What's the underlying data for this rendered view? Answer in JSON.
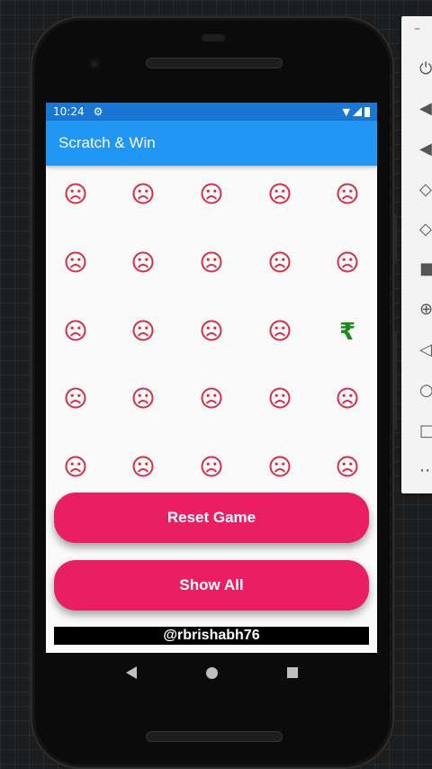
{
  "status_bar": {
    "time": "10:24"
  },
  "app_bar": {
    "title": "Scratch & Win"
  },
  "grid": {
    "rows": 5,
    "cols": 5,
    "cells": [
      [
        "sad",
        "sad",
        "sad",
        "sad",
        "sad"
      ],
      [
        "sad",
        "sad",
        "sad",
        "sad",
        "sad"
      ],
      [
        "sad",
        "sad",
        "sad",
        "sad",
        "rupee"
      ],
      [
        "sad",
        "sad",
        "sad",
        "sad",
        "sad"
      ],
      [
        "sad",
        "sad",
        "sad",
        "sad",
        "sad"
      ]
    ],
    "rupee_symbol": "₹",
    "sad_color": "#d32f45",
    "rupee_color": "#1e8a1e"
  },
  "buttons": {
    "reset_label": "Reset Game",
    "show_all_label": "Show All"
  },
  "credit": "@rbrishabh76",
  "colors": {
    "primary": "#2196f3",
    "primary_dark": "#1976d2",
    "accent": "#e91e63"
  }
}
